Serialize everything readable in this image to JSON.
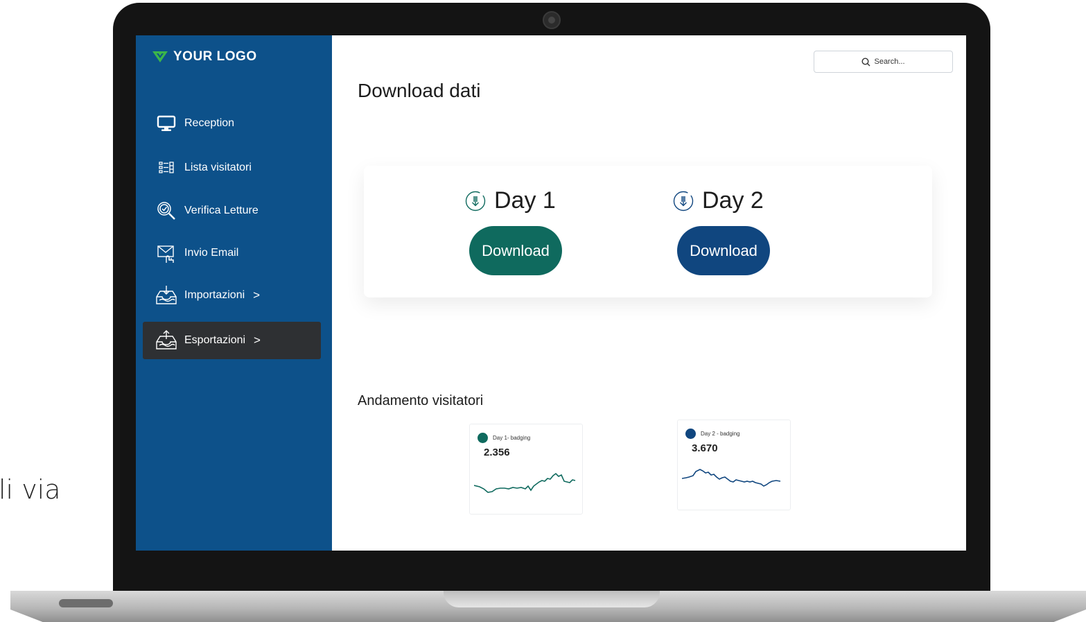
{
  "background_text": "li via",
  "sidebar": {
    "logo": "YOUR LOGO",
    "items": [
      {
        "label": "Reception",
        "icon": "monitor-icon"
      },
      {
        "label": "Lista visitatori",
        "icon": "list-icon"
      },
      {
        "label": "Verifica Letture",
        "icon": "magnify-check-icon"
      },
      {
        "label": "Invio Email",
        "icon": "email-hand-icon"
      },
      {
        "label": "Importazioni",
        "icon": "inbox-import-icon",
        "chevron": ">"
      },
      {
        "label": "Esportazioni",
        "icon": "inbox-export-icon",
        "chevron": ">",
        "active": true
      }
    ]
  },
  "search": {
    "placeholder": "Search..."
  },
  "main": {
    "title": "Download dati",
    "days": [
      {
        "label": "Day 1",
        "button": "Download",
        "color": "#0f6a5e"
      },
      {
        "label": "Day 2",
        "button": "Download",
        "color": "#10467f"
      }
    ],
    "section_title": "Andamento visitatori",
    "cards": [
      {
        "legend": "Day 1- badging",
        "value": "2.356",
        "color": "#0f6a5e"
      },
      {
        "legend": "Day 2 - badging",
        "value": "3.670",
        "color": "#10467f"
      }
    ]
  },
  "colors": {
    "sidebar": "#0d518a",
    "active": "#2e3033",
    "logo_accent": "#3bb54a"
  }
}
